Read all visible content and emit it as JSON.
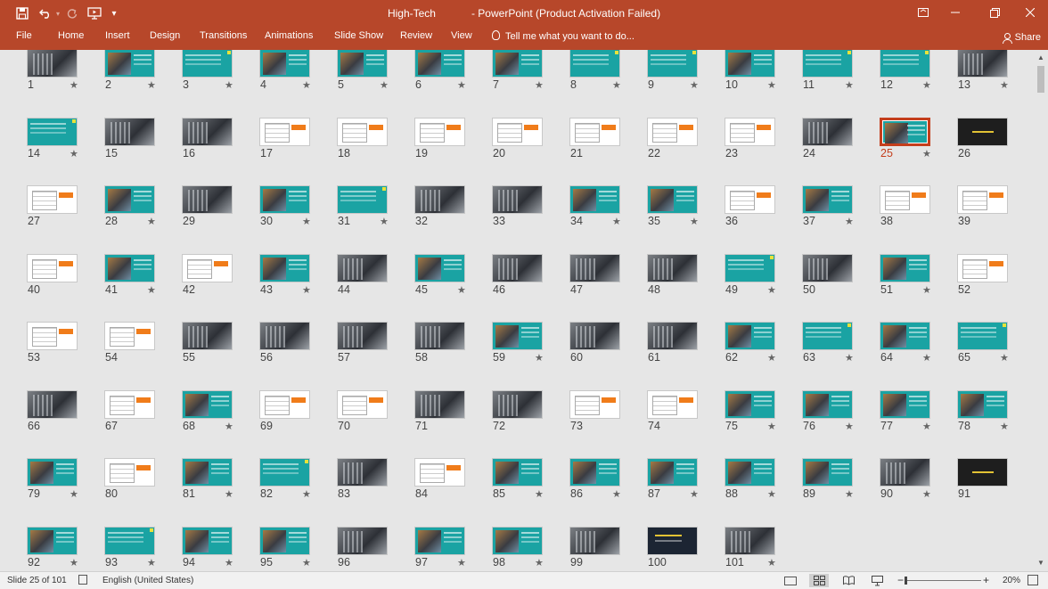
{
  "titlebar": {
    "doc_name": "High-Tech",
    "app_status": "- PowerPoint (Product Activation Failed)",
    "icons": [
      "save-icon",
      "undo-icon",
      "redo-icon",
      "start-from-beginning-icon",
      "customize-qat-icon",
      "ribbon-display-options-icon",
      "minimize-icon",
      "restore-icon",
      "close-icon"
    ]
  },
  "ribbon": {
    "tabs": [
      "File",
      "Home",
      "Insert",
      "Design",
      "Transitions",
      "Animations",
      "Slide Show",
      "Review",
      "View"
    ],
    "tell_me": "Tell me what you want to do...",
    "share": "Share"
  },
  "sorter": {
    "selected": 25,
    "slides": [
      {
        "n": "1",
        "kind": "photo",
        "star": true
      },
      {
        "n": "2",
        "kind": "tphoto",
        "star": true
      },
      {
        "n": "3",
        "kind": "teal",
        "star": true
      },
      {
        "n": "4",
        "kind": "tphoto",
        "star": true
      },
      {
        "n": "5",
        "kind": "tphoto",
        "star": true
      },
      {
        "n": "6",
        "kind": "tphoto",
        "star": true
      },
      {
        "n": "7",
        "kind": "tphoto",
        "star": true
      },
      {
        "n": "8",
        "kind": "teal",
        "star": true
      },
      {
        "n": "9",
        "kind": "teal",
        "star": true
      },
      {
        "n": "10",
        "kind": "tphoto",
        "star": true
      },
      {
        "n": "11",
        "kind": "teal",
        "star": true
      },
      {
        "n": "12",
        "kind": "teal",
        "star": true
      },
      {
        "n": "13",
        "kind": "photo",
        "star": true
      },
      {
        "n": "14",
        "kind": "teal",
        "star": true
      },
      {
        "n": "15",
        "kind": "photo",
        "star": false
      },
      {
        "n": "16",
        "kind": "photo",
        "star": false
      },
      {
        "n": "17",
        "kind": "white",
        "star": false
      },
      {
        "n": "18",
        "kind": "white",
        "star": false
      },
      {
        "n": "19",
        "kind": "white",
        "star": false
      },
      {
        "n": "20",
        "kind": "white",
        "star": false
      },
      {
        "n": "21",
        "kind": "white",
        "star": false
      },
      {
        "n": "22",
        "kind": "white",
        "star": false
      },
      {
        "n": "23",
        "kind": "white",
        "star": false
      },
      {
        "n": "24",
        "kind": "photo",
        "star": false
      },
      {
        "n": "25",
        "kind": "tphoto",
        "star": true
      },
      {
        "n": "26",
        "kind": "dark",
        "star": false
      },
      {
        "n": "27",
        "kind": "white",
        "star": false
      },
      {
        "n": "28",
        "kind": "tphoto",
        "star": true
      },
      {
        "n": "29",
        "kind": "photo",
        "star": false
      },
      {
        "n": "30",
        "kind": "tphoto",
        "star": true
      },
      {
        "n": "31",
        "kind": "teal",
        "star": true
      },
      {
        "n": "32",
        "kind": "photo",
        "star": false
      },
      {
        "n": "33",
        "kind": "photo",
        "star": false
      },
      {
        "n": "34",
        "kind": "tphoto",
        "star": true
      },
      {
        "n": "35",
        "kind": "tphoto",
        "star": true
      },
      {
        "n": "36",
        "kind": "white",
        "star": false
      },
      {
        "n": "37",
        "kind": "tphoto",
        "star": true
      },
      {
        "n": "38",
        "kind": "white",
        "star": false
      },
      {
        "n": "39",
        "kind": "white",
        "star": false
      },
      {
        "n": "40",
        "kind": "white",
        "star": false
      },
      {
        "n": "41",
        "kind": "tphoto",
        "star": true
      },
      {
        "n": "42",
        "kind": "white",
        "star": false
      },
      {
        "n": "43",
        "kind": "tphoto",
        "star": true
      },
      {
        "n": "44",
        "kind": "photo",
        "star": false
      },
      {
        "n": "45",
        "kind": "tphoto",
        "star": true
      },
      {
        "n": "46",
        "kind": "photo",
        "star": false
      },
      {
        "n": "47",
        "kind": "photo",
        "star": false
      },
      {
        "n": "48",
        "kind": "photo",
        "star": false
      },
      {
        "n": "49",
        "kind": "teal",
        "star": true
      },
      {
        "n": "50",
        "kind": "photo",
        "star": false
      },
      {
        "n": "51",
        "kind": "tphoto",
        "star": true
      },
      {
        "n": "52",
        "kind": "white",
        "star": false
      },
      {
        "n": "53",
        "kind": "white",
        "star": false
      },
      {
        "n": "54",
        "kind": "white",
        "star": false
      },
      {
        "n": "55",
        "kind": "photo",
        "star": false
      },
      {
        "n": "56",
        "kind": "photo",
        "star": false
      },
      {
        "n": "57",
        "kind": "photo",
        "star": false
      },
      {
        "n": "58",
        "kind": "photo",
        "star": false
      },
      {
        "n": "59",
        "kind": "tphoto",
        "star": true
      },
      {
        "n": "60",
        "kind": "photo",
        "star": false
      },
      {
        "n": "61",
        "kind": "photo",
        "star": false
      },
      {
        "n": "62",
        "kind": "tphoto",
        "star": true
      },
      {
        "n": "63",
        "kind": "teal",
        "star": true
      },
      {
        "n": "64",
        "kind": "tphoto",
        "star": true
      },
      {
        "n": "65",
        "kind": "teal",
        "star": true
      },
      {
        "n": "66",
        "kind": "photo",
        "star": false
      },
      {
        "n": "67",
        "kind": "white",
        "star": false
      },
      {
        "n": "68",
        "kind": "tphoto",
        "star": true
      },
      {
        "n": "69",
        "kind": "white",
        "star": false
      },
      {
        "n": "70",
        "kind": "white",
        "star": false
      },
      {
        "n": "71",
        "kind": "photo",
        "star": false
      },
      {
        "n": "72",
        "kind": "photo",
        "star": false
      },
      {
        "n": "73",
        "kind": "white",
        "star": false
      },
      {
        "n": "74",
        "kind": "white",
        "star": false
      },
      {
        "n": "75",
        "kind": "tphoto",
        "star": true
      },
      {
        "n": "76",
        "kind": "tphoto",
        "star": true
      },
      {
        "n": "77",
        "kind": "tphoto",
        "star": true
      },
      {
        "n": "78",
        "kind": "tphoto",
        "star": true
      },
      {
        "n": "79",
        "kind": "tphoto",
        "star": true
      },
      {
        "n": "80",
        "kind": "white",
        "star": false
      },
      {
        "n": "81",
        "kind": "tphoto",
        "star": true
      },
      {
        "n": "82",
        "kind": "teal",
        "star": true
      },
      {
        "n": "83",
        "kind": "photo",
        "star": false
      },
      {
        "n": "84",
        "kind": "white",
        "star": false
      },
      {
        "n": "85",
        "kind": "tphoto",
        "star": true
      },
      {
        "n": "86",
        "kind": "tphoto",
        "star": true
      },
      {
        "n": "87",
        "kind": "tphoto",
        "star": true
      },
      {
        "n": "88",
        "kind": "tphoto",
        "star": true
      },
      {
        "n": "89",
        "kind": "tphoto",
        "star": true
      },
      {
        "n": "90",
        "kind": "photo",
        "star": true
      },
      {
        "n": "91",
        "kind": "dark",
        "star": false
      },
      {
        "n": "92",
        "kind": "tphoto",
        "star": true
      },
      {
        "n": "93",
        "kind": "teal",
        "star": true
      },
      {
        "n": "94",
        "kind": "tphoto",
        "star": true
      },
      {
        "n": "95",
        "kind": "tphoto",
        "star": true
      },
      {
        "n": "96",
        "kind": "photo",
        "star": false
      },
      {
        "n": "97",
        "kind": "tphoto",
        "star": true
      },
      {
        "n": "98",
        "kind": "tphoto",
        "star": true
      },
      {
        "n": "99",
        "kind": "photo",
        "star": false
      },
      {
        "n": "100",
        "kind": "navy",
        "star": false
      },
      {
        "n": "101",
        "kind": "photo",
        "star": true
      }
    ]
  },
  "statusbar": {
    "slide_count": "Slide 25 of 101",
    "language": "English (United States)",
    "zoom": "20%",
    "view_buttons": [
      "normal-view",
      "slide-sorter-view",
      "reading-view",
      "slide-show-view"
    ],
    "active_view": "slide-sorter-view"
  },
  "colors": {
    "accent": "#b7472a",
    "selected_border": "#c43e1c",
    "teal": "#1aa3a3",
    "background": "#e6e6e6"
  }
}
